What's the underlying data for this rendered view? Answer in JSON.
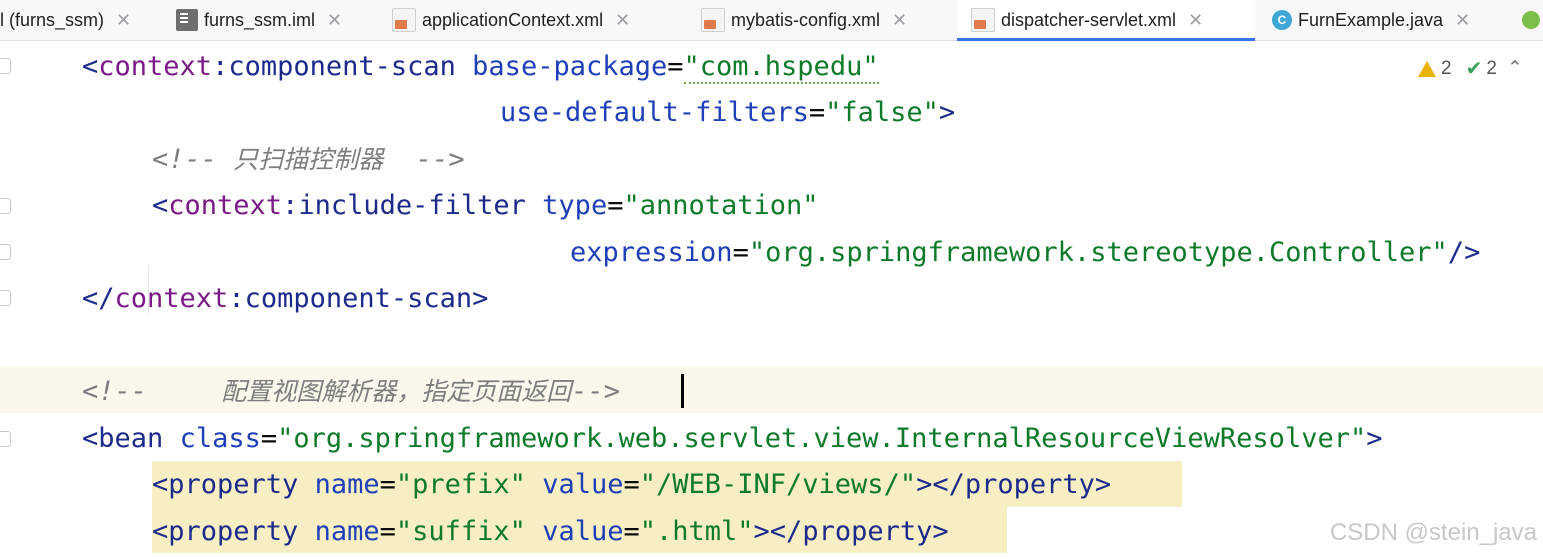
{
  "tabs": [
    {
      "label": "(furns_ssm)",
      "icon": "project-icon",
      "active": false,
      "prefix": "l "
    },
    {
      "label": "furns_ssm.iml",
      "icon": "iml-file-icon",
      "active": false
    },
    {
      "label": "applicationContext.xml",
      "icon": "xml-file-icon",
      "active": false
    },
    {
      "label": "mybatis-config.xml",
      "icon": "xml-file-icon",
      "active": false
    },
    {
      "label": "dispatcher-servlet.xml",
      "icon": "xml-file-icon",
      "active": true
    },
    {
      "label": "FurnExample.java",
      "icon": "java-class-icon",
      "active": false
    }
  ],
  "inspections": {
    "warnings": "2",
    "weak_warnings": "2"
  },
  "code": {
    "l1": {
      "open": "<",
      "ns": "context",
      "colon": ":",
      "name": "component-scan",
      "attr": "base-package",
      "eq": "=",
      "val": "\"com.hspedu\""
    },
    "l2": {
      "attr": "use-default-filters",
      "eq": "=",
      "val": "\"false\"",
      "close": ">"
    },
    "l3": {
      "comment_start": "<!-- ",
      "comment_text": "只扫描控制器",
      "comment_end": "  -->"
    },
    "l4": {
      "open": "<",
      "ns": "context",
      "colon": ":",
      "name": "include-filter",
      "attr": "type",
      "eq": "=",
      "val": "\"annotation\""
    },
    "l5": {
      "attr": "expression",
      "eq": "=",
      "val": "\"org.springframework.stereotype.Controller\"",
      "close": "/>"
    },
    "l6": {
      "open": "</",
      "ns": "context",
      "colon": ":",
      "name": "component-scan",
      "close": ">"
    },
    "l7": {
      "comment_start": "<!-- ",
      "comment_text": "配置视图解析器，指定页面返回",
      "comment_end": "-->"
    },
    "l8": {
      "open": "<",
      "name": "bean",
      "attr": "class",
      "eq": "=",
      "val": "\"org.springframework.web.servlet.view.InternalResourceViewResolver\"",
      "close": ">"
    },
    "l9": {
      "open": "<",
      "name": "property",
      "attr1": "name",
      "val1": "\"prefix\"",
      "attr2": "value",
      "val2": "\"/WEB-INF/views/\"",
      "mid": "></",
      "close": ">"
    },
    "l10": {
      "open": "<",
      "name": "property",
      "attr1": "name",
      "val1": "\"suffix\"",
      "attr2": "value",
      "val2": "\".html\"",
      "mid": "></",
      "close": ">"
    }
  },
  "watermark": "CSDN @stein_java",
  "colors": {
    "accent": "#3574f0",
    "tag": "#1c2a8c",
    "namespace": "#7a1a86",
    "attribute": "#1f3fb8",
    "string": "#0f7a2a",
    "comment": "#7d7d7d",
    "highlight": "#f7eec3"
  }
}
